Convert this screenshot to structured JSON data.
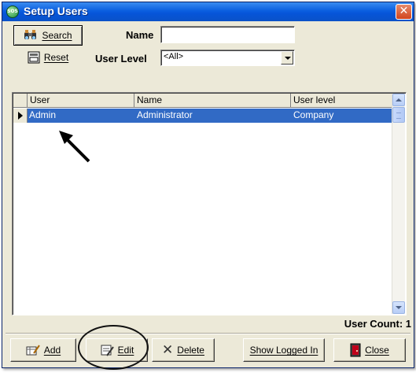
{
  "window": {
    "title": "Setup Users",
    "icon": "sos-app-icon"
  },
  "toolbar": {
    "search_label": "Search",
    "search_mnemonic": "S",
    "reset_label": "Reset",
    "reset_mnemonic": "R"
  },
  "filters": {
    "name_label": "Name",
    "name_value": "",
    "user_level_label": "User Level",
    "user_level_value": "<All>"
  },
  "grid": {
    "columns": [
      "User",
      "Name",
      "User level"
    ],
    "rows": [
      {
        "user": "Admin",
        "name": "Administrator",
        "level": "Company"
      }
    ]
  },
  "footer": {
    "user_count": "User Count: 1"
  },
  "buttons": {
    "add": "Add",
    "edit": "Edit",
    "delete": "Delete",
    "show_logged_in": "Show Logged In",
    "close": "Close"
  },
  "colors": {
    "selection": "#316ac5",
    "titlebar": "#0a5ee0",
    "close_button": "#d2451e"
  }
}
